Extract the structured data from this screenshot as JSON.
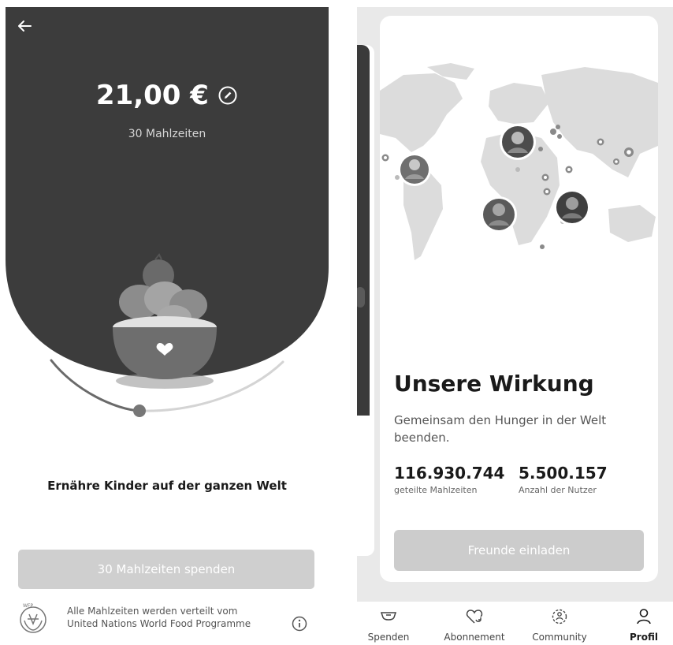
{
  "donation_screen": {
    "back_icon": "arrow-left-icon",
    "amount": "21,00 €",
    "edit_icon": "pencil-circle-icon",
    "meals_label": "30 Mahlzeiten",
    "illustration": "food-bowl-with-heart",
    "tagline": "Ernähre Kinder auf der ganzen Welt",
    "donate_button": "30 Mahlzeiten spenden",
    "wfp_logo_text": "WFP",
    "wfp_line1": "Alle Mahlzeiten werden verteilt vom",
    "wfp_line2": "United Nations World Food Programme",
    "info_icon": "info-circle-icon"
  },
  "impact_screen": {
    "map": "world-map-with-user-avatars",
    "title": "Unsere Wirkung",
    "description": "Gemeinsam den Hunger in der Welt beenden.",
    "stats": [
      {
        "value": "116.930.744",
        "label": "geteilte Mahlzeiten"
      },
      {
        "value": "5.500.157",
        "label": "Anzahl der Nutzer"
      }
    ],
    "invite_button": "Freunde einladen"
  },
  "bottom_nav": [
    {
      "label": "Spenden",
      "icon": "bowl-icon",
      "active": false
    },
    {
      "label": "Abonnement",
      "icon": "heart-refresh-icon",
      "active": false
    },
    {
      "label": "Community",
      "icon": "community-icon",
      "active": false
    },
    {
      "label": "Profil",
      "icon": "person-icon",
      "active": true
    }
  ],
  "colors": {
    "dark": "#3c3c3c",
    "button_grey": "#cfcfcf",
    "background_grey": "#e9e9e9",
    "map_grey": "#dcdcdc"
  }
}
